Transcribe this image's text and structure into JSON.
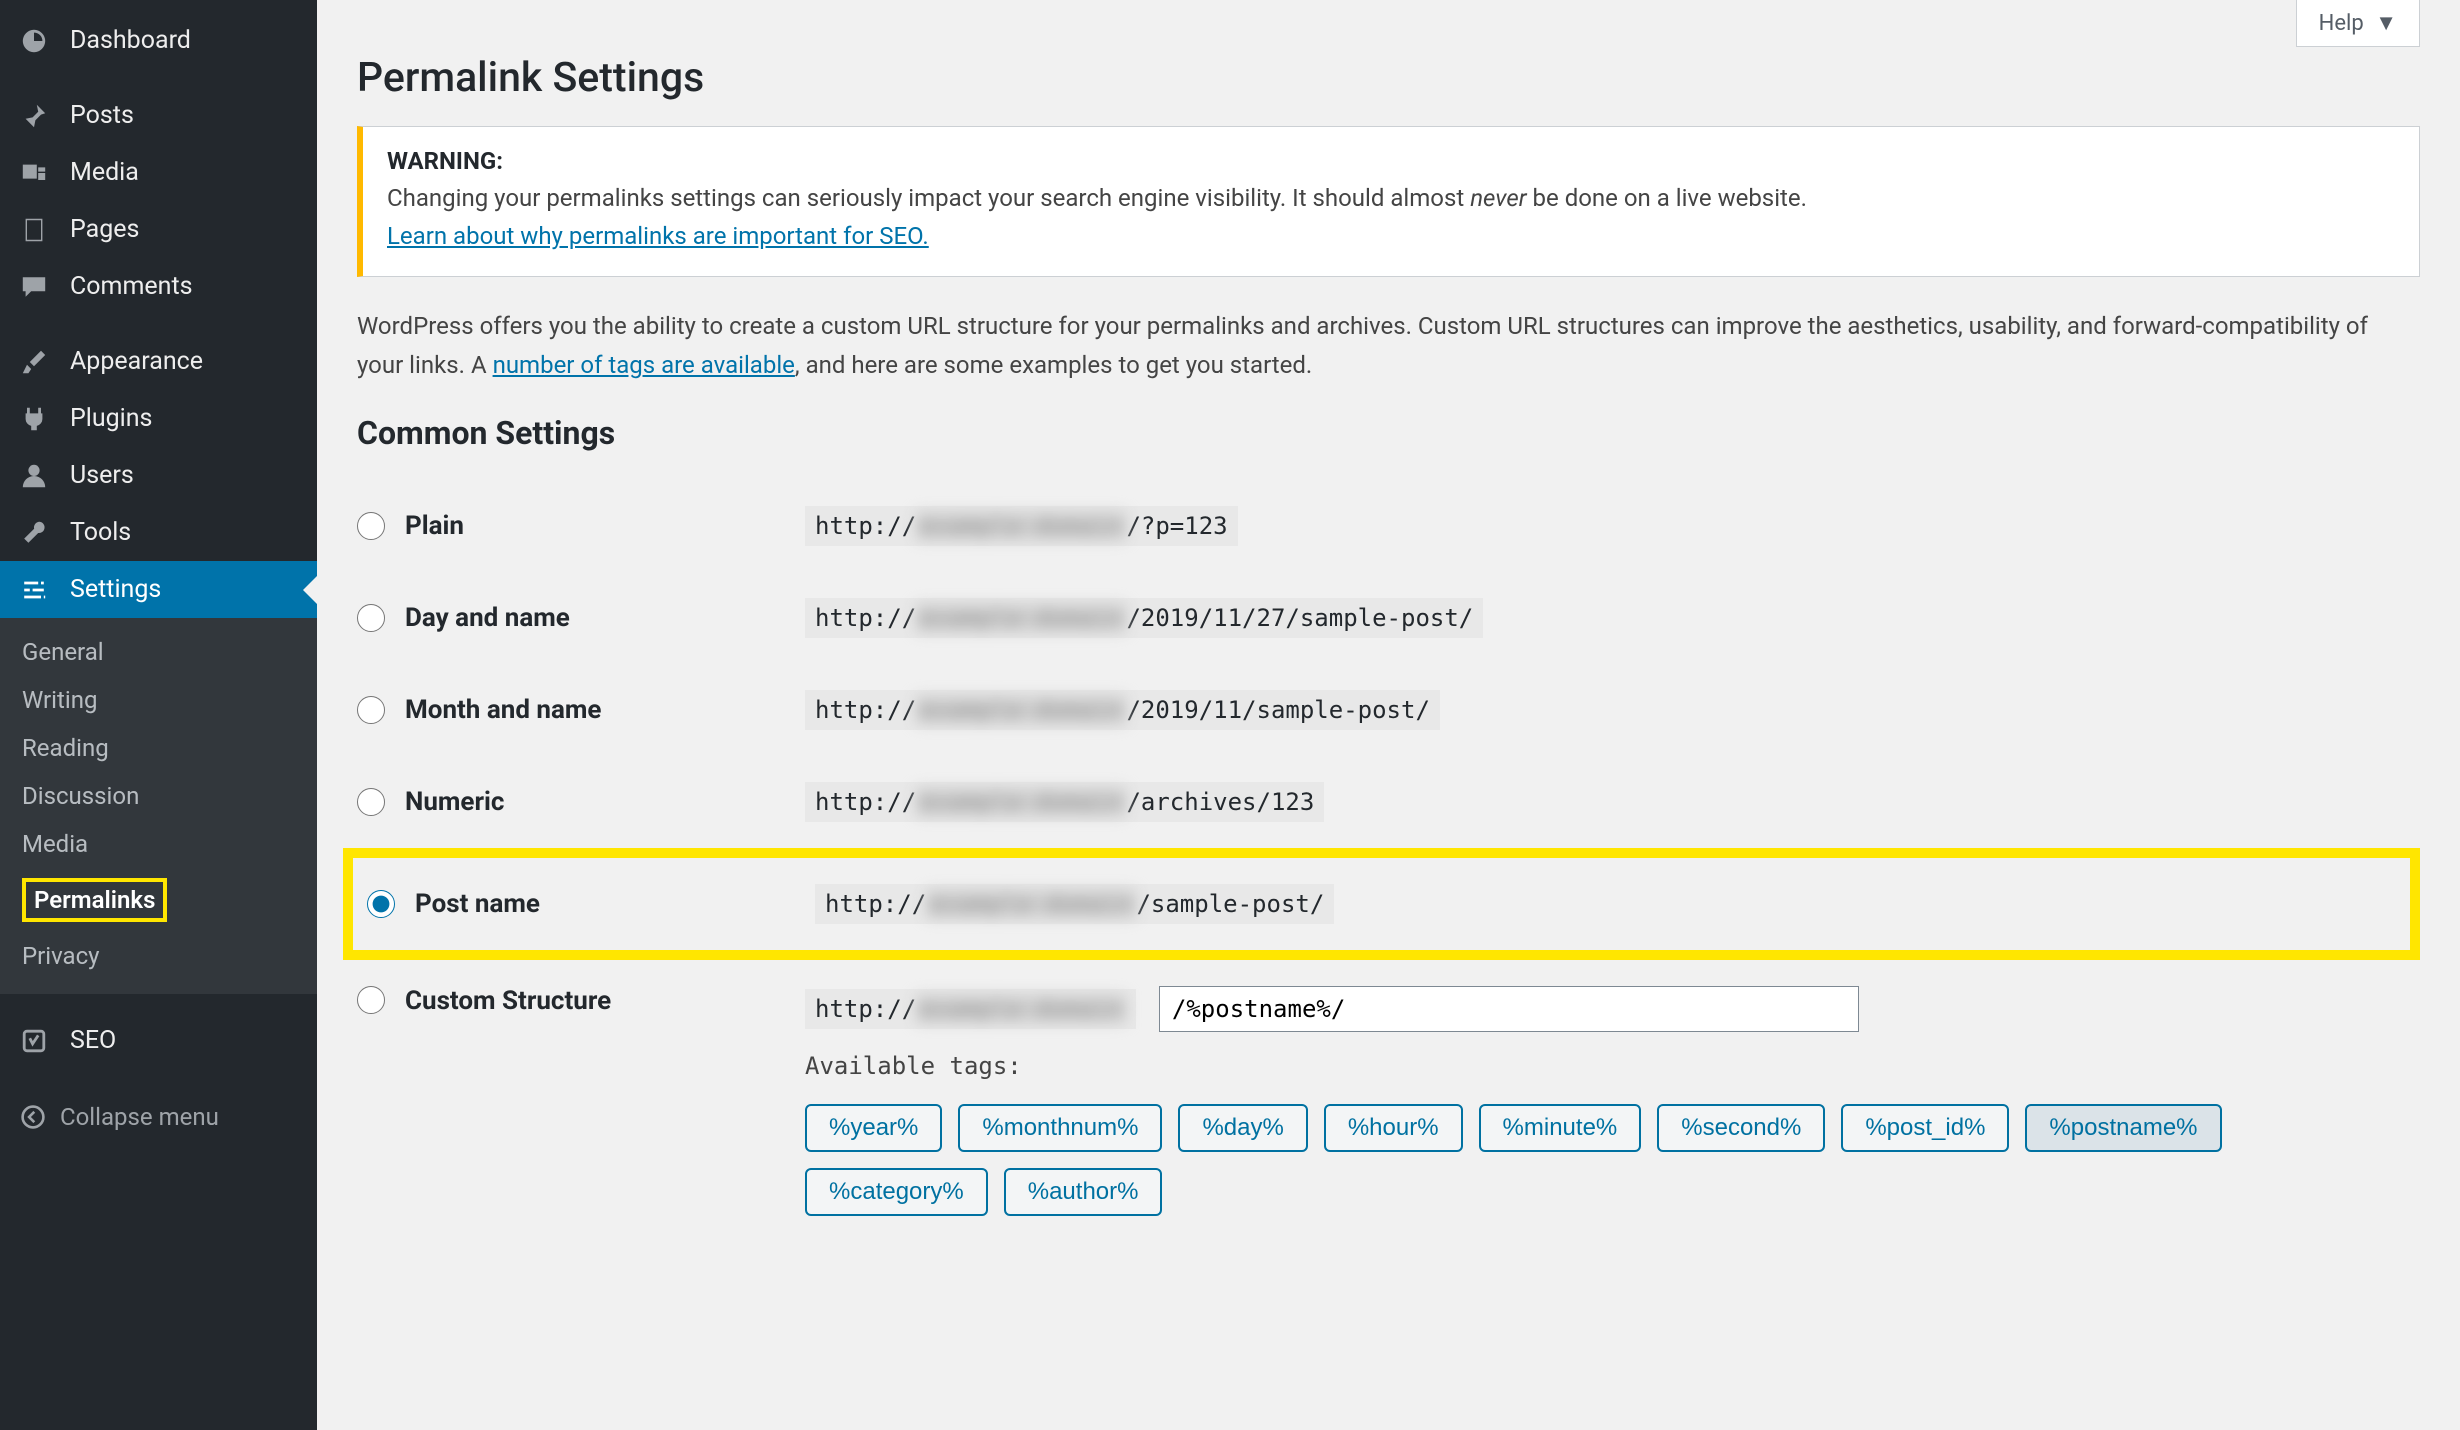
{
  "sidebar": {
    "items": [
      {
        "label": "Dashboard",
        "icon": "dashboard-icon"
      },
      {
        "label": "Posts",
        "icon": "pin-icon"
      },
      {
        "label": "Media",
        "icon": "media-icon"
      },
      {
        "label": "Pages",
        "icon": "page-icon"
      },
      {
        "label": "Comments",
        "icon": "comment-icon"
      },
      {
        "label": "Appearance",
        "icon": "brush-icon"
      },
      {
        "label": "Plugins",
        "icon": "plug-icon"
      },
      {
        "label": "Users",
        "icon": "user-icon"
      },
      {
        "label": "Tools",
        "icon": "wrench-icon"
      },
      {
        "label": "Settings",
        "icon": "sliders-icon",
        "active": true
      },
      {
        "label": "SEO",
        "icon": "seo-icon"
      }
    ],
    "submenu": [
      {
        "label": "General"
      },
      {
        "label": "Writing"
      },
      {
        "label": "Reading"
      },
      {
        "label": "Discussion"
      },
      {
        "label": "Media"
      },
      {
        "label": "Permalinks",
        "current": true,
        "highlighted": true
      },
      {
        "label": "Privacy"
      }
    ],
    "collapse_label": "Collapse menu"
  },
  "help_label": "Help",
  "page_title": "Permalink Settings",
  "notice": {
    "warning_label": "WARNING:",
    "text_before_em": "Changing your permalinks settings can seriously impact your search engine visibility. It should almost ",
    "em_word": "never",
    "text_after_em": " be done on a live website.",
    "link_text": "Learn about why permalinks are important for SEO."
  },
  "intro": {
    "text_before_link": "WordPress offers you the ability to create a custom URL structure for your permalinks and archives. Custom URL structures can improve the aesthetics, usability, and forward-compatibility of your links. A ",
    "link_text": "number of tags are available",
    "text_after_link": ", and here are some examples to get you started."
  },
  "common_settings_title": "Common Settings",
  "options": [
    {
      "key": "plain",
      "label": "Plain",
      "prefix": "http://",
      "suffix": "/?p=123"
    },
    {
      "key": "day_name",
      "label": "Day and name",
      "prefix": "http://",
      "suffix": "/2019/11/27/sample-post/"
    },
    {
      "key": "month_name",
      "label": "Month and name",
      "prefix": "http://",
      "suffix": "/2019/11/sample-post/"
    },
    {
      "key": "numeric",
      "label": "Numeric",
      "prefix": "http://",
      "suffix": "/archives/123"
    },
    {
      "key": "post_name",
      "label": "Post name",
      "prefix": "http://",
      "suffix": "/sample-post/",
      "selected": true,
      "highlighted": true
    },
    {
      "key": "custom",
      "label": "Custom Structure",
      "prefix": "http://",
      "input_value": "/%postname%/"
    }
  ],
  "available_tags_label": "Available tags:",
  "tags": [
    {
      "label": "%year%"
    },
    {
      "label": "%monthnum%"
    },
    {
      "label": "%day%"
    },
    {
      "label": "%hour%"
    },
    {
      "label": "%minute%"
    },
    {
      "label": "%second%"
    },
    {
      "label": "%post_id%"
    },
    {
      "label": "%postname%",
      "active": true
    },
    {
      "label": "%category%"
    },
    {
      "label": "%author%"
    }
  ]
}
